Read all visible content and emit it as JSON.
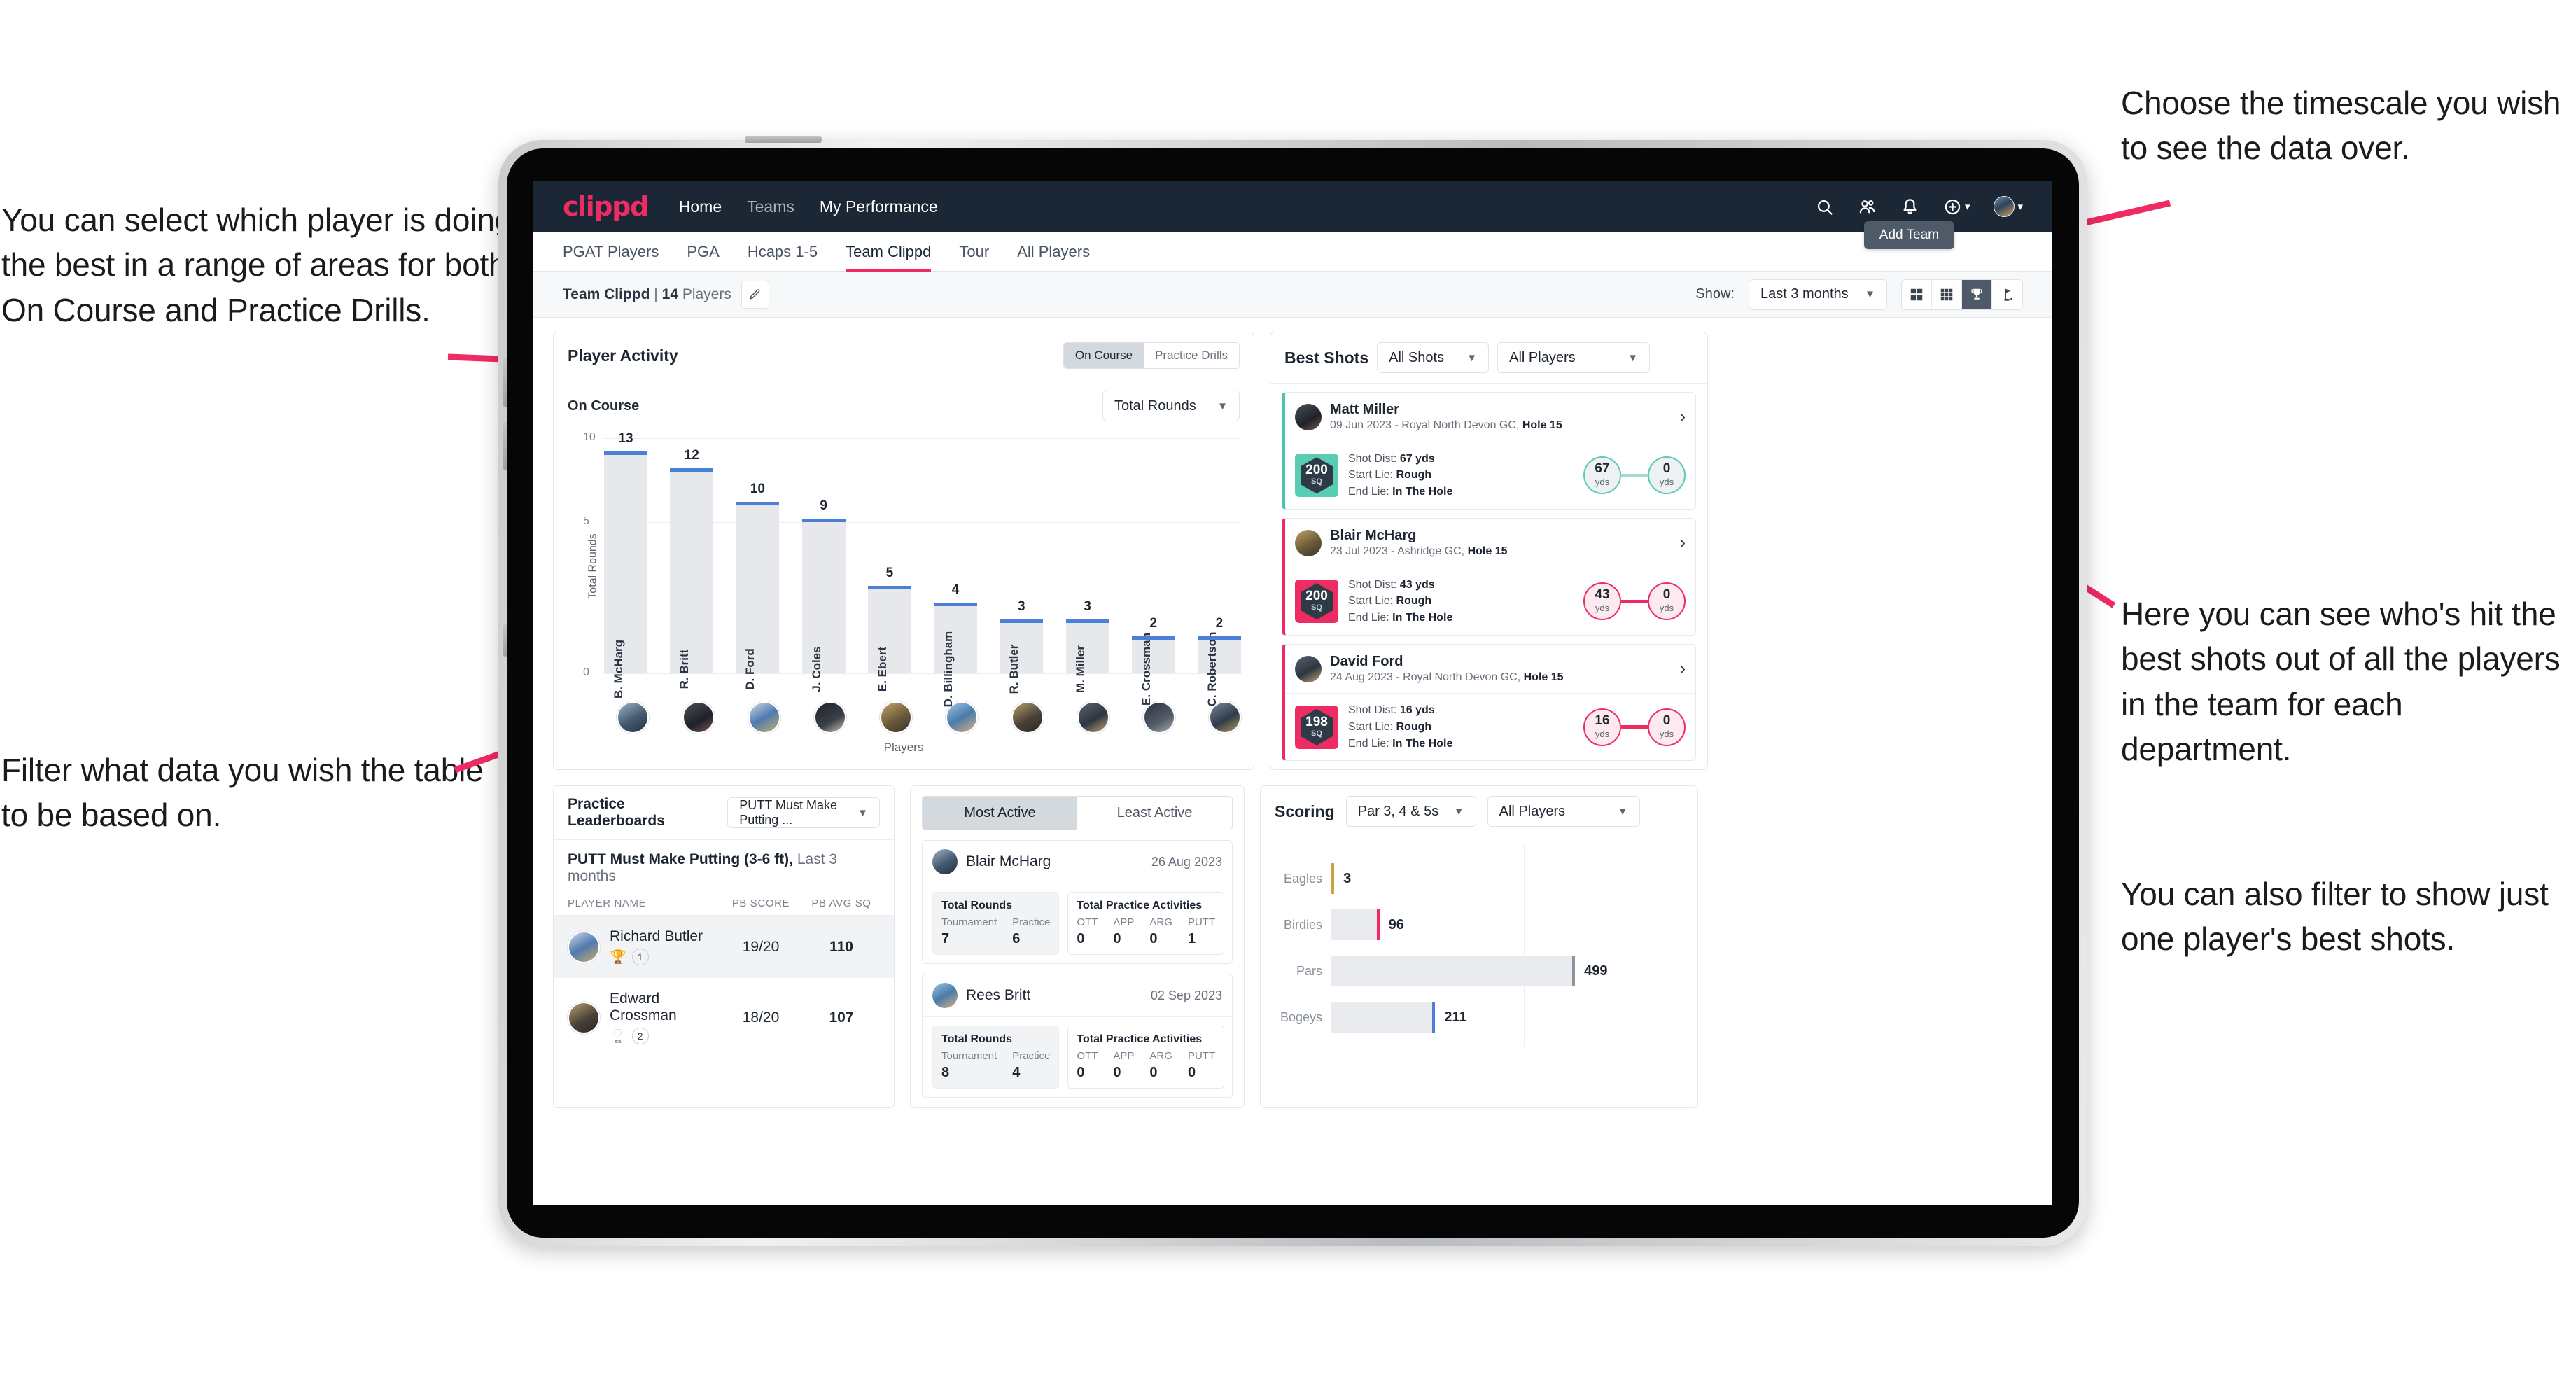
{
  "annotations": {
    "left_top": "You can select which player is doing the best in a range of areas for both On Course and Practice Drills.",
    "left_bottom": "Filter what data you wish the table to be based on.",
    "right_top": "Choose the timescale you wish to see the data over.",
    "right_middle": "Here you can see who's hit the best shots out of all the players in the team for each department.",
    "right_bottom": "You can also filter to show just one player's best shots."
  },
  "appbar": {
    "logo": "clippd",
    "links": [
      "Home",
      "Teams",
      "My Performance"
    ],
    "icons": [
      "search-icon",
      "people-icon",
      "bell-icon",
      "plus-circle-icon",
      "avatar"
    ]
  },
  "tabs": {
    "items": [
      "PGAT Players",
      "PGA",
      "Hcaps 1-5",
      "Team Clippd",
      "Tour",
      "All Players"
    ],
    "active": "Team Clippd",
    "add_team": "Add Team"
  },
  "subbar": {
    "team_name": "Team Clippd",
    "separator": "|",
    "player_count": "14",
    "players_word": "Players",
    "show_label": "Show:",
    "timescale": "Last 3 months",
    "views": [
      "grid-2x2-icon",
      "grid-3x3-icon",
      "trophy-icon",
      "golf-flag-icon"
    ],
    "active_view": "trophy-icon"
  },
  "player_activity": {
    "title": "Player Activity",
    "segments": [
      "On Course",
      "Practice Drills"
    ],
    "active_segment": "On Course",
    "sub_label": "On Course",
    "metric_select": "Total Rounds"
  },
  "best_shots": {
    "title": "Best Shots",
    "shot_filter": "All Shots",
    "player_filter": "All Players",
    "cards": [
      {
        "name": "Matt Miller",
        "meta_date": "09 Jun 2023",
        "meta_course": "Royal North Devon GC,",
        "meta_hole": "Hole 15",
        "sq": "200",
        "sq_unit": "SQ",
        "shot_dist_label": "Shot Dist:",
        "shot_dist": "67 yds",
        "start_lie_label": "Start Lie:",
        "start_lie": "Rough",
        "end_lie_label": "End Lie:",
        "end_lie": "In The Hole",
        "from_val": "67",
        "from_unit": "yds",
        "to_val": "0",
        "to_unit": "yds",
        "accent": "#58cdb3"
      },
      {
        "name": "Blair McHarg",
        "meta_date": "23 Jul 2023",
        "meta_course": "Ashridge GC,",
        "meta_hole": "Hole 15",
        "sq": "200",
        "sq_unit": "SQ",
        "shot_dist_label": "Shot Dist:",
        "shot_dist": "43 yds",
        "start_lie_label": "Start Lie:",
        "start_lie": "Rough",
        "end_lie_label": "End Lie:",
        "end_lie": "In The Hole",
        "from_val": "43",
        "from_unit": "yds",
        "to_val": "0",
        "to_unit": "yds",
        "accent": "#ef2b63"
      },
      {
        "name": "David Ford",
        "meta_date": "24 Aug 2023",
        "meta_course": "Royal North Devon GC,",
        "meta_hole": "Hole 15",
        "sq": "198",
        "sq_unit": "SQ",
        "shot_dist_label": "Shot Dist:",
        "shot_dist": "16 yds",
        "start_lie_label": "Start Lie:",
        "start_lie": "Rough",
        "end_lie_label": "End Lie:",
        "end_lie": "In The Hole",
        "from_val": "16",
        "from_unit": "yds",
        "to_val": "0",
        "to_unit": "yds",
        "accent": "#ef2b63"
      }
    ]
  },
  "practice_leaderboards": {
    "title": "Practice Leaderboards",
    "drill_select": "PUTT Must Make Putting ...",
    "subtitle_bold": "PUTT Must Make Putting (3-6 ft),",
    "subtitle_thin": "Last 3 months",
    "columns": [
      "PLAYER NAME",
      "PB SCORE",
      "PB AVG SQ"
    ],
    "rows": [
      {
        "name": "Richard Butler",
        "rank": "1",
        "pb_score": "19/20",
        "pb_avg_sq": "110",
        "trophy": "gold"
      },
      {
        "name": "Edward Crossman",
        "rank": "2",
        "pb_score": "18/20",
        "pb_avg_sq": "107",
        "trophy": "silver"
      }
    ]
  },
  "activity_panel": {
    "tabs": [
      "Most Active",
      "Least Active"
    ],
    "active_tab": "Most Active",
    "cards": [
      {
        "name": "Blair McHarg",
        "date": "26 Aug 2023",
        "rounds_title": "Total Rounds",
        "rounds_keys": [
          "Tournament",
          "Practice"
        ],
        "rounds_vals": [
          "7",
          "6"
        ],
        "practice_title": "Total Practice Activities",
        "practice_keys": [
          "OTT",
          "APP",
          "ARG",
          "PUTT"
        ],
        "practice_vals": [
          "0",
          "0",
          "0",
          "1"
        ]
      },
      {
        "name": "Rees Britt",
        "date": "02 Sep 2023",
        "rounds_title": "Total Rounds",
        "rounds_keys": [
          "Tournament",
          "Practice"
        ],
        "rounds_vals": [
          "8",
          "4"
        ],
        "practice_title": "Total Practice Activities",
        "practice_keys": [
          "OTT",
          "APP",
          "ARG",
          "PUTT"
        ],
        "practice_vals": [
          "0",
          "0",
          "0",
          "0"
        ]
      }
    ]
  },
  "scoring": {
    "title": "Scoring",
    "par_filter": "Par 3, 4 & 5s",
    "player_filter": "All Players"
  },
  "chart_data": [
    {
      "type": "bar",
      "title": "Player Activity - On Course",
      "xlabel": "Players",
      "ylabel": "Total Rounds",
      "categories": [
        "B. McHarg",
        "R. Britt",
        "D. Ford",
        "J. Coles",
        "E. Ebert",
        "D. Billingham",
        "R. Butler",
        "M. Miller",
        "E. Crossman",
        "C. Robertson"
      ],
      "values": [
        13,
        12,
        10,
        9,
        5,
        4,
        3,
        3,
        2,
        2
      ],
      "yticks": [
        0,
        5,
        10
      ],
      "ylim": [
        0,
        14
      ],
      "grid": true,
      "bar_color": "#e6e8ec",
      "cap_color": "#4a80d8"
    },
    {
      "type": "bar",
      "orientation": "horizontal",
      "title": "Scoring",
      "categories": [
        "Eagles",
        "Birdies",
        "Pars",
        "Bogeys"
      ],
      "values": [
        3,
        96,
        499,
        211
      ],
      "colors": [
        "#c9a14a",
        "#ef2b63",
        "#8e959d",
        "#4a80d8"
      ],
      "xlim": [
        0,
        620
      ],
      "grid": true
    }
  ]
}
